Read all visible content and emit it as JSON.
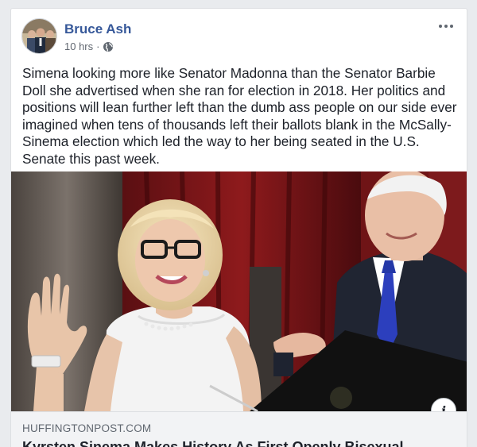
{
  "post": {
    "author": "Bruce Ash",
    "timestamp": "10 hrs",
    "separator": "·",
    "privacy_icon": "globe-icon",
    "menu_icon": "more-horizontal-icon",
    "text": "Simena looking more like Senator Madonna than the Senator Barbie Doll she advertised when she ran for election in 2018. Her politics and positions will lean further left than the dumb ass people on our side ever imagined when tens of thousands left their ballots blank in the McSally-Sinema election which led the way to her being seated in the U.S. Senate this past week."
  },
  "link_preview": {
    "domain": "HUFFINGTONPOST.COM",
    "title": "Kyrsten Sinema Makes History As First Openly Bisexual",
    "info_icon": "info-icon",
    "info_label": "i"
  },
  "colors": {
    "author_link": "#365899",
    "text": "#1d2129",
    "meta": "#616770",
    "footer_bg": "#f2f3f5",
    "page_bg": "#e9ebee"
  }
}
